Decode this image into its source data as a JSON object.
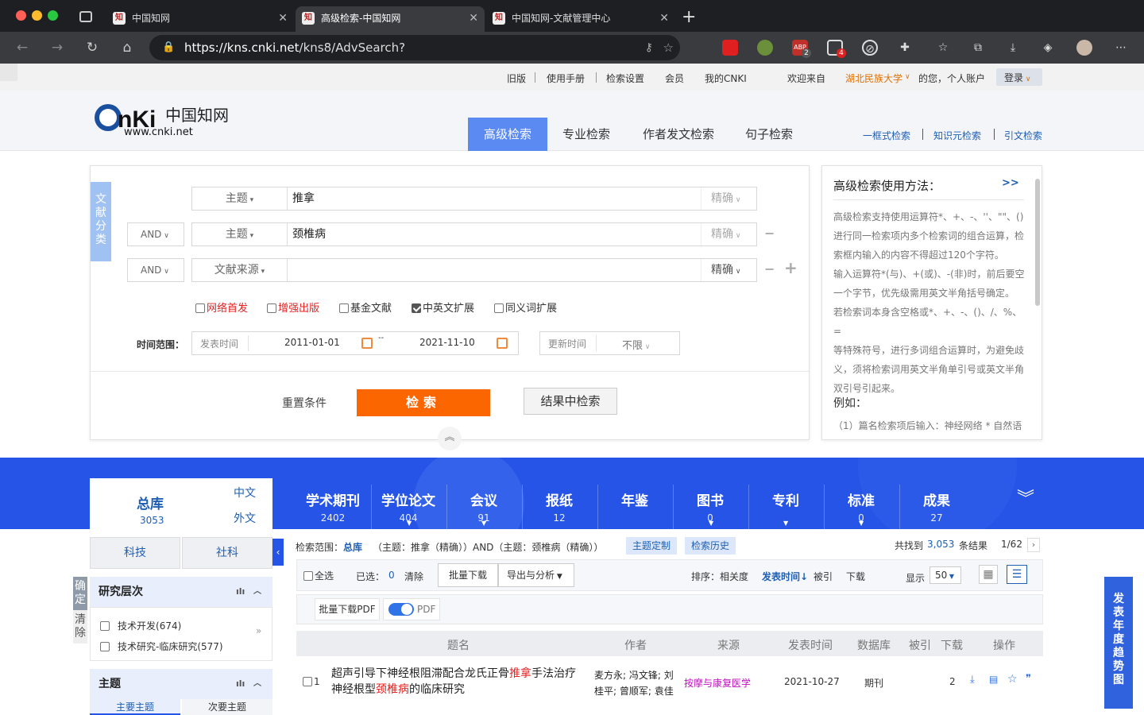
{
  "browser": {
    "tabs": [
      {
        "title": "中国知网",
        "active": false
      },
      {
        "title": "高级检索-中国知网",
        "active": true
      },
      {
        "title": "中国知网-文献管理中心",
        "active": false
      }
    ],
    "url_host": "https://kns.cnki.net",
    "url_path": "/kns8/AdvSearch?dbprefix=SCDB&&crossDbcodes=CJFQ%2CCD...",
    "badge_abp": "2",
    "badge_ext": "4"
  },
  "topnav": {
    "old": "旧版",
    "manual": "使用手册",
    "settings": "检索设置",
    "member": "会员",
    "mycnki": "我的CNKI",
    "welcome": "欢迎来自",
    "org": "湖北民族大学",
    "account": "的您，个人账户",
    "login": "登录"
  },
  "header": {
    "logo_text": "CNKi中国知网",
    "logo_url": "www.cnki.net",
    "search_tabs": [
      "高级检索",
      "专业检索",
      "作者发文检索",
      "句子检索"
    ],
    "right_links": [
      "一框式检索",
      "知识元检索",
      "引文检索"
    ]
  },
  "search": {
    "category_label": "文献分类",
    "rows": [
      {
        "logic": "",
        "field": "主题",
        "keyword": "推拿",
        "exact": "精确"
      },
      {
        "logic": "AND",
        "field": "主题",
        "keyword": "颈椎病",
        "exact": "精确"
      },
      {
        "logic": "AND",
        "field": "文献来源",
        "keyword": "",
        "exact": "精确"
      }
    ],
    "options": [
      {
        "label": "网络首发",
        "checked": false,
        "red": true
      },
      {
        "label": "增强出版",
        "checked": false,
        "red": true
      },
      {
        "label": "基金文献",
        "checked": false,
        "red": false
      },
      {
        "label": "中英文扩展",
        "checked": true,
        "red": false
      },
      {
        "label": "同义词扩展",
        "checked": false,
        "red": false
      }
    ],
    "time_label": "时间范围：",
    "pub_time_label": "发表时间",
    "date_from": "2011-01-01",
    "date_sep": "--",
    "date_to": "2021-11-10",
    "update_label": "更新时间",
    "update_value": "不限",
    "reset": "重置条件",
    "search_btn": "检索",
    "in_results": "结果中检索"
  },
  "help": {
    "title": "高级检索使用方法：",
    "more": ">>",
    "lines": [
      "高级检索支持使用运算符*、+、-、''、\"\"、()",
      "进行同一检索项内多个检索词的组合运算，检",
      "索框内输入的内容不得超过120个字符。",
      "输入运算符*(与)、+(或)、-(非)时，前后要空",
      "一个字节，优先级需用英文半角括号确定。",
      "若检索词本身含空格或*、+、-、()、/、%、=",
      "等特殊符号，进行多词组合运算时，为避免歧",
      "义，须将检索词用英文半角单引号或英文半角",
      "双引号引起来。"
    ],
    "example_label": "例如：",
    "example_1": "（1）篇名检索项后输入：神经网络 * 自然语"
  },
  "dbtabs": {
    "total_label": "总库",
    "total_count": "3053",
    "lang_cn": "中文",
    "lang_en": "外文",
    "tabs": [
      {
        "name": "学术期刊",
        "count": "2402"
      },
      {
        "name": "学位论文",
        "count": "404"
      },
      {
        "name": "会议",
        "count": "91"
      },
      {
        "name": "报纸",
        "count": "12"
      },
      {
        "name": "年鉴",
        "count": ""
      },
      {
        "name": "图书",
        "count": "0"
      },
      {
        "name": "专利",
        "count": ""
      },
      {
        "name": "标准",
        "count": "0"
      },
      {
        "name": "成果",
        "count": "27"
      }
    ]
  },
  "facets": {
    "sci": "科技",
    "social": "社科",
    "confirm": "确定",
    "clear": "清除",
    "level_title": "研究层次",
    "level_items": [
      {
        "label": "技术开发",
        "count": "(674)"
      },
      {
        "label": "技术研究-临床研究",
        "count": "(577)"
      }
    ],
    "topic_title": "主题",
    "topic_tabs": [
      "主要主题",
      "次要主题"
    ]
  },
  "results": {
    "scope_label": "检索范围：",
    "scope_db": "总库",
    "scope_query": "（主题：推拿（精确））AND（主题：颈椎病（精确））",
    "topic_custom": "主题定制",
    "history": "检索历史",
    "found_prefix": "共找到",
    "found_count": "3,053",
    "found_suffix": "条结果",
    "page": "1/62",
    "select_all": "全选",
    "selected_label": "已选：",
    "selected_count": "0",
    "clear": "清除",
    "batch_download": "批量下载",
    "export": "导出与分析",
    "sort_label": "排序：",
    "sort_relevance": "相关度",
    "sort_date": "发表时间",
    "sort_cited": "被引",
    "sort_download": "下载",
    "show_label": "显示",
    "show_value": "50",
    "batch_pdf": "批量下载PDF",
    "pdf_label": "PDF",
    "columns": [
      "题名",
      "作者",
      "来源",
      "发表时间",
      "数据库",
      "被引",
      "下载",
      "操作"
    ],
    "rows": [
      {
        "index": "1",
        "title_a": "超声引导下神经根阻滞配合龙氏正骨",
        "title_hl1": "推拿",
        "title_b": "手法治疗",
        "title_c": "神经根型",
        "title_hl2": "颈椎病",
        "title_d": "的临床研究",
        "authors_1": "麦方永; 冯文锋; 刘",
        "authors_2": "桂平; 曾顺军; 袁佳",
        "source": "按摩与康复医学",
        "date": "2021-10-27",
        "db": "期刊",
        "cited": "",
        "downloads": "2"
      }
    ]
  },
  "trend": "发表年度趋势图"
}
